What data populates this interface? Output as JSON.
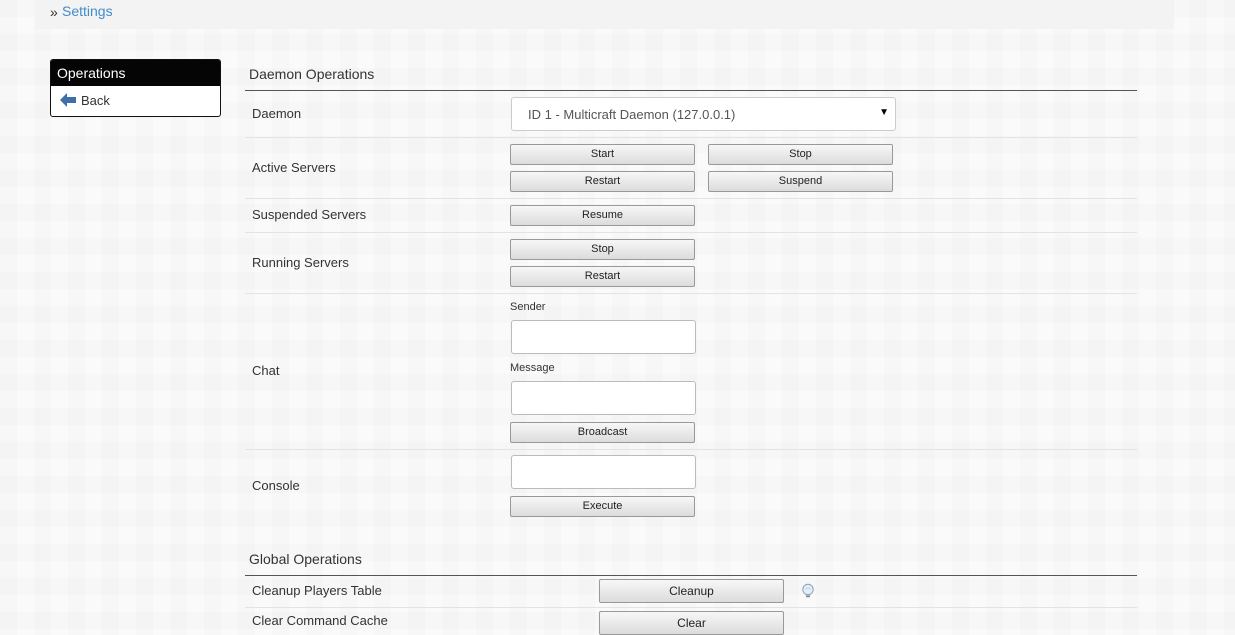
{
  "breadcrumb": {
    "separator": "»",
    "current": "Settings"
  },
  "sidebar": {
    "title": "Operations",
    "items": [
      {
        "label": "Back",
        "icon": "back-arrow-icon"
      }
    ]
  },
  "daemon_operations": {
    "title": "Daemon Operations",
    "daemon": {
      "label": "Daemon",
      "selected": "ID 1 - Multicraft Daemon (127.0.0.1)"
    },
    "active_servers": {
      "label": "Active Servers",
      "start": "Start",
      "stop": "Stop",
      "restart": "Restart",
      "suspend": "Suspend"
    },
    "suspended_servers": {
      "label": "Suspended Servers",
      "resume": "Resume"
    },
    "running_servers": {
      "label": "Running Servers",
      "stop": "Stop",
      "restart": "Restart"
    },
    "chat": {
      "label": "Chat",
      "sender_label": "Sender",
      "sender_value": "",
      "message_label": "Message",
      "message_value": "",
      "broadcast": "Broadcast"
    },
    "console": {
      "label": "Console",
      "value": "",
      "execute": "Execute"
    }
  },
  "global_operations": {
    "title": "Global Operations",
    "cleanup_players": {
      "label": "Cleanup Players Table",
      "button": "Cleanup",
      "icon": "lightbulb-icon"
    },
    "clear_command_cache": {
      "label": "Clear Command Cache",
      "button": "Clear"
    }
  },
  "colors": {
    "link": "#428bca",
    "sidebar_header": "#050505",
    "back_icon": "#3f6fa6"
  }
}
